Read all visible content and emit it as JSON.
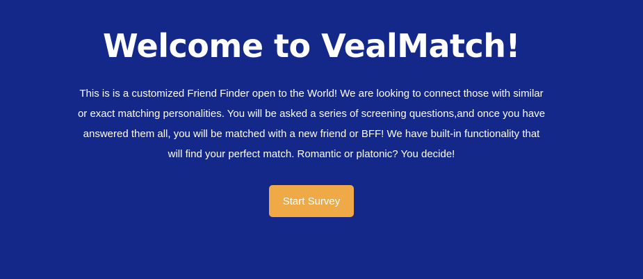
{
  "hero": {
    "title": "Welcome to VealMatch!",
    "description": "This is is a customized Friend Finder open to the World! We are looking to connect those with similar or exact matching personalities. You will be asked a series of screening questions,and once you have answered them all, you will be matched with a new friend or BFF! We have built-in functionality that will find your perfect match. Romantic or platonic? You decide!"
  },
  "actions": {
    "start_label": "Start Survey"
  },
  "colors": {
    "background": "#14288a",
    "button": "#efaa47",
    "text": "#ffffff"
  }
}
